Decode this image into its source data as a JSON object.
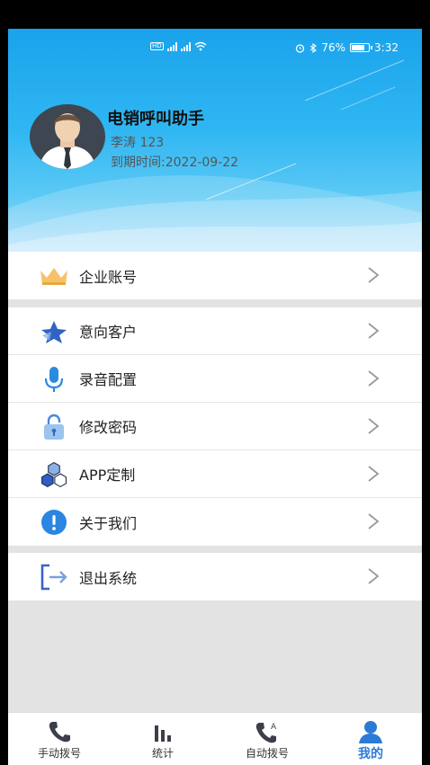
{
  "status_bar": {
    "battery": "76%",
    "time": "3:32"
  },
  "header": {
    "app_title": "电销呼叫助手",
    "user": "李涛  123",
    "expire": "到期时间:2022-09-22"
  },
  "menu": {
    "group1": [
      {
        "label": "企业账号",
        "icon": "crown-icon"
      }
    ],
    "group2": [
      {
        "label": "意向客户",
        "icon": "star-icon"
      },
      {
        "label": "录音配置",
        "icon": "microphone-icon"
      },
      {
        "label": "修改密码",
        "icon": "lock-icon"
      },
      {
        "label": "APP定制",
        "icon": "hexagon-cluster-icon"
      },
      {
        "label": "关于我们",
        "icon": "info-icon"
      }
    ],
    "group3": [
      {
        "label": "退出系统",
        "icon": "logout-icon"
      }
    ]
  },
  "tabs": [
    {
      "label": "手动拨号",
      "icon": "phone-icon"
    },
    {
      "label": "统计",
      "icon": "bar-chart-icon"
    },
    {
      "label": "自动拨号",
      "icon": "auto-dial-icon"
    },
    {
      "label": "我的",
      "icon": "user-icon",
      "active": true
    }
  ],
  "colors": {
    "accent": "#2a7bd6",
    "header_blue": "#1aa3ec",
    "background": "#e3e3e3"
  }
}
